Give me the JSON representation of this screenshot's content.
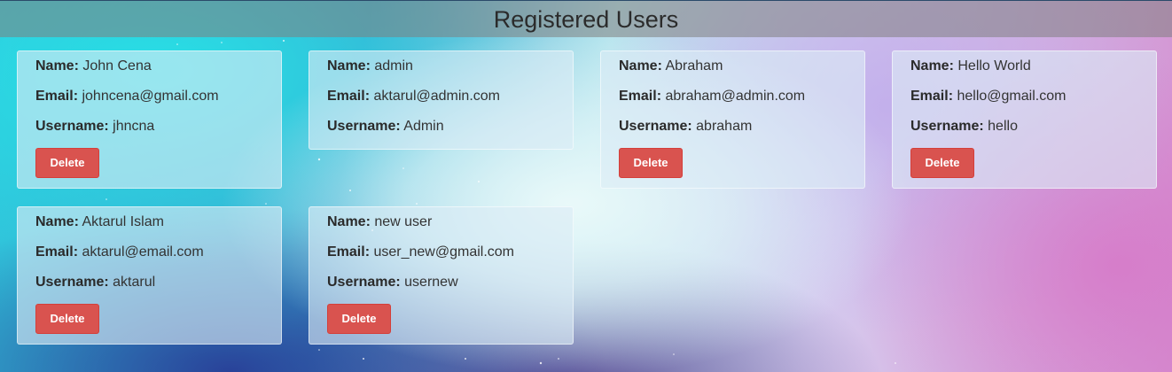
{
  "header": {
    "title": "Registered Users"
  },
  "labels": {
    "name": "Name:",
    "email": "Email:",
    "username": "Username:"
  },
  "users": [
    {
      "name": "John Cena",
      "email": "johncena@gmail.com",
      "username": "jhncna",
      "delete_label": "Delete"
    },
    {
      "name": "admin",
      "email": "aktarul@admin.com",
      "username": "Admin"
    },
    {
      "name": "Abraham",
      "email": "abraham@admin.com",
      "username": "abraham",
      "delete_label": "Delete"
    },
    {
      "name": "Hello World",
      "email": "hello@gmail.com",
      "username": "hello",
      "delete_label": "Delete"
    },
    {
      "name": "Aktarul Islam",
      "email": "aktarul@email.com",
      "username": "aktarul",
      "delete_label": "Delete"
    },
    {
      "name": "new user",
      "email": "user_new@gmail.com",
      "username": "usernew",
      "delete_label": "Delete"
    }
  ],
  "colors": {
    "delete_button": "#d9534f",
    "header_bar": "#808080"
  }
}
